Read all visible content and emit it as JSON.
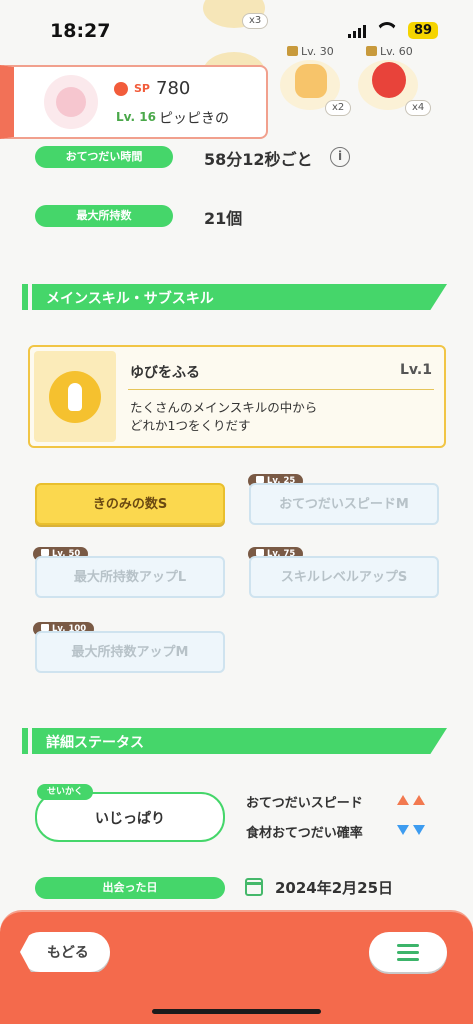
{
  "status_bar": {
    "time": "18:27",
    "battery": "89"
  },
  "ingredients": [
    {
      "name": "ingredient-1",
      "count": "x3",
      "level": ""
    },
    {
      "name": "ingredient-2",
      "count": "x2",
      "level": "Lv. 30"
    },
    {
      "name": "ingredient-3",
      "count": "x4",
      "level": "Lv. 60"
    }
  ],
  "pokemon": {
    "sp_label": "SP",
    "sp_value": "780",
    "level": "Lv. 16",
    "name": "ピッピきの"
  },
  "info": {
    "help_time_label": "おてつだい時間",
    "help_time_value": "58分12秒ごと",
    "max_carry_label": "最大所持数",
    "max_carry_value": "21個"
  },
  "skills_section": {
    "title": "メインスキル・サブスキル",
    "main_skill": {
      "name": "ゆびをふる",
      "level": "Lv.1",
      "description_line1": "たくさんのメインスキルの中から",
      "description_line2": "どれか1つをくりだす"
    },
    "sub_skills": [
      {
        "label": "きのみの数S",
        "unlock": ""
      },
      {
        "label": "おてつだいスピードM",
        "unlock": "Lv. 25"
      },
      {
        "label": "最大所持数アップL",
        "unlock": "Lv. 50"
      },
      {
        "label": "スキルレベルアップS",
        "unlock": "Lv. 75"
      },
      {
        "label": "最大所持数アップM",
        "unlock": "Lv. 100"
      }
    ]
  },
  "details_section": {
    "title": "詳細ステータス",
    "nature_tag": "せいかく",
    "nature_value": "いじっぱり",
    "stat_up": "おてつだいスピード",
    "stat_down": "食材おてつだい確率",
    "met_date_label": "出会った日",
    "met_date_value": "2024年2月25日"
  },
  "bottom_nav": {
    "back_label": "もどる",
    "menu_icon": "hamburger-menu-icon"
  },
  "colors": {
    "accent_green": "#45d66a",
    "bottom_bar": "#f46a4c",
    "up_arrow": "#f2794f",
    "down_arrow": "#3d9cf0"
  }
}
